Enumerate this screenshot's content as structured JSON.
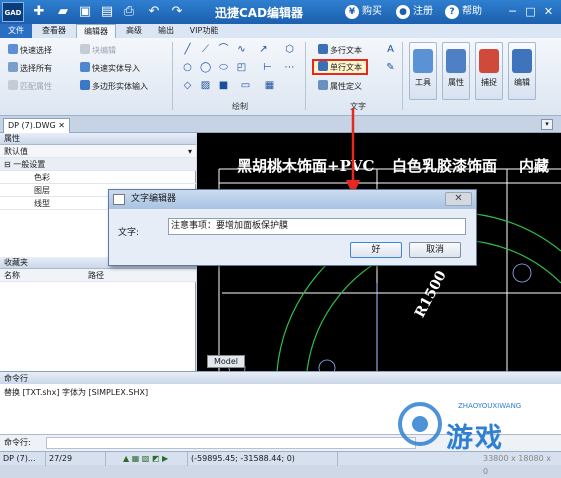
{
  "app": {
    "logo": "GAD",
    "title": "迅捷CAD编辑器",
    "actions": [
      {
        "icon": "yen-icon",
        "label": "购买"
      },
      {
        "icon": "user-icon",
        "label": "注册"
      },
      {
        "icon": "help-icon",
        "label": "帮助"
      }
    ]
  },
  "menu": {
    "tabs": [
      "文件",
      "查看器",
      "编辑器",
      "高级",
      "输出",
      "VIP功能"
    ],
    "active": "编辑器"
  },
  "ribbon": {
    "left_items": [
      "快速选择",
      "选择所有",
      "匹配属性"
    ],
    "block_items": [
      "块编辑",
      "快速实体导入",
      "多边形实体输入"
    ],
    "draw_label": "绘制",
    "text_items": [
      "多行文本",
      "单行文本",
      "属性定义"
    ],
    "text_label": "文字",
    "big_buttons": [
      "工具",
      "属性",
      "捕捉",
      "编辑"
    ]
  },
  "document": {
    "tab": "DP (7).DWG"
  },
  "properties": {
    "header": "属性",
    "dropdown": "默认值",
    "group": "一般设置",
    "rows": [
      "色彩",
      "图层",
      "线型"
    ]
  },
  "favorites": {
    "header": "收藏夹",
    "columns": [
      "名称",
      "路径"
    ]
  },
  "canvas": {
    "texts": [
      "黑胡桃木饰面+PVC",
      "白色乳胶漆饰面",
      "内藏",
      "R1500"
    ],
    "model_tab": "Model"
  },
  "dialog": {
    "title": "文字编辑器",
    "label": "文字:",
    "value": "注意事项：要增加面板保护膜",
    "ok": "好",
    "cancel": "取消"
  },
  "command": {
    "header": "命令行",
    "output": "替换 [TXT.shx] 字体为 [SIMPLEX.SHX]",
    "input_label": "命令行:"
  },
  "status": {
    "file": "DP (7)...",
    "page": "27/29",
    "coords": "(-59895.45; -31588.44; 0)",
    "size": "33800 x 18080 x 0"
  },
  "watermark": {
    "text": "游戏",
    "sub": "ZHAOYOUXIWANG"
  },
  "colors": {
    "title_bar": "#1c5fae",
    "highlight": "#e8281e",
    "canvas_bg": "#000000"
  }
}
